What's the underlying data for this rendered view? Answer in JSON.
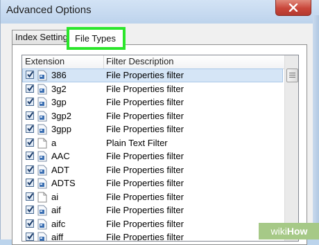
{
  "window": {
    "title": "Advanced Options"
  },
  "tabs": [
    {
      "label": "Index Settings",
      "active": false
    },
    {
      "label": "File Types",
      "active": true
    }
  ],
  "table": {
    "columns": [
      "Extension",
      "Filter Description"
    ],
    "rows": [
      {
        "checked": true,
        "icon": "filter-file-icon",
        "extension": "386",
        "description": "File Properties filter",
        "selected": true
      },
      {
        "checked": true,
        "icon": "filter-file-icon",
        "extension": "3g2",
        "description": "File Properties filter"
      },
      {
        "checked": true,
        "icon": "filter-file-icon",
        "extension": "3gp",
        "description": "File Properties filter"
      },
      {
        "checked": true,
        "icon": "filter-file-icon",
        "extension": "3gp2",
        "description": "File Properties filter"
      },
      {
        "checked": true,
        "icon": "filter-file-icon",
        "extension": "3gpp",
        "description": "File Properties filter"
      },
      {
        "checked": true,
        "icon": "blank-file-icon",
        "extension": "a",
        "description": "Plain Text Filter"
      },
      {
        "checked": true,
        "icon": "filter-file-icon",
        "extension": "AAC",
        "description": "File Properties filter"
      },
      {
        "checked": true,
        "icon": "filter-file-icon",
        "extension": "ADT",
        "description": "File Properties filter"
      },
      {
        "checked": true,
        "icon": "filter-file-icon",
        "extension": "ADTS",
        "description": "File Properties filter"
      },
      {
        "checked": true,
        "icon": "blank-file-icon",
        "extension": "ai",
        "description": "File Properties filter"
      },
      {
        "checked": true,
        "icon": "filter-file-icon",
        "extension": "aif",
        "description": "File Properties filter"
      },
      {
        "checked": true,
        "icon": "filter-file-icon",
        "extension": "aifc",
        "description": "File Properties filter"
      },
      {
        "checked": true,
        "icon": "filter-file-icon",
        "extension": "aiff",
        "description": "File Properties filter"
      }
    ]
  },
  "watermark": {
    "prefix": "wiki",
    "suffix": "How"
  },
  "colors": {
    "highlight": "#2be62b",
    "close_button": "#c9463a",
    "selected_row": "#d5e5f6"
  }
}
